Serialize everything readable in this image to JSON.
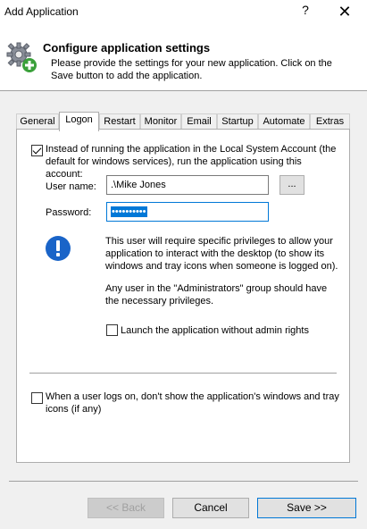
{
  "window": {
    "title": "Add Application",
    "help_label": "?",
    "close_label": "✕"
  },
  "header": {
    "title": "Configure application settings",
    "description": "Please provide the settings for your new application. Click on the Save button to add the application."
  },
  "tabs": [
    {
      "label": "General"
    },
    {
      "label": "Logon",
      "active": true
    },
    {
      "label": "Restart"
    },
    {
      "label": "Monitor"
    },
    {
      "label": "Email"
    },
    {
      "label": "Startup"
    },
    {
      "label": "Automate"
    },
    {
      "label": "Extras"
    }
  ],
  "logon": {
    "run_as_account": {
      "checked": true,
      "label": "Instead of running the application in the Local System Account (the default for windows services), run the application using this account:"
    },
    "user_name_label": "User name:",
    "user_name_value": ".\\Mike Jones",
    "browse_label": "...",
    "password_label": "Password:",
    "password_value": "••••••••••",
    "info_text_1": "This user will require specific privileges to allow your application to interact with the desktop (to show its windows and tray icons when someone is logged on).",
    "info_text_2": "Any user in the \"Administrators\" group should have the necessary privileges.",
    "launch_without_admin": {
      "checked": false,
      "label": "Launch the application without admin rights"
    },
    "hide_windows": {
      "checked": false,
      "label": "When a user logs on, don't show the application's windows and tray icons (if any)"
    }
  },
  "buttons": {
    "back": "<< Back",
    "cancel": "Cancel",
    "save": "Save >>"
  },
  "colors": {
    "accent": "#0078d7",
    "info_icon": "#1a64c8"
  }
}
